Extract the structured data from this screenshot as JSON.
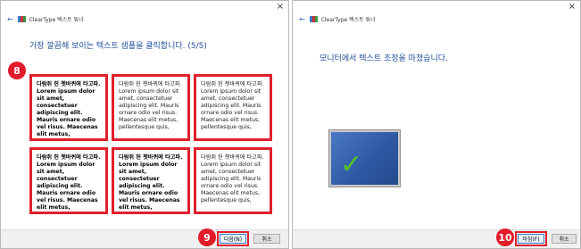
{
  "wizard1": {
    "title": "ClearType 텍스트 튜너",
    "close_glyph": "×",
    "back_glyph": "←",
    "heading": "가장 깔끔해 보이는 텍스트 샘플을 클릭합니다. (5/5)",
    "step_badge": "8",
    "samples": [
      {
        "text": "다람쥐 헌 쳇바퀴에 타고파. Lorem ipsum dolor sit amet, consectetuer adipiscing elit. Mauris ornare odio vel risus. Maecenas elit metus, pellentesque quis,"
      },
      {
        "text": "다람쥐 헌 쳇바퀴에 타고파. Lorem ipsum dolor sit amet, consectetuer adipiscing elit. Mauris ornare odio vel risus. Maecenas elit metus, pellentesque quis,"
      },
      {
        "text": "다람쥐 헌 쳇바퀴에 타고파. Lorem ipsum dolor sit amet, consectetuer adipiscing elit. Mauris ornare odio vel risus. Maecenas elit metus, pellentesque quis,"
      },
      {
        "text": "다람쥐 헌 쳇바퀴에 타고파. Lorem ipsum dolor sit amet, consectetuer adipiscing elit. Mauris ornare odio vel risus. Maecenas elit metus, pellentesque quis,"
      },
      {
        "text": "다람쥐 헌 쳇바퀴에 타고파. Lorem ipsum dolor sit amet, consectetuer adipiscing elit. Mauris ornare odio vel risus. Maecenas elit metus, pellentesque quis,"
      },
      {
        "text": "다람쥐 헌 쳇바퀴에 타고파. Lorem ipsum dolor sit amet, consectetuer adipiscing elit. Mauris ornare odio vel risus. Maecenas elit metus, pellentesque quis,"
      }
    ],
    "footer": {
      "badge": "9",
      "next_label": "다음(N)",
      "cancel_label": "취소"
    }
  },
  "wizard2": {
    "title": "ClearType 텍스트 튜너",
    "close_glyph": "×",
    "back_glyph": "←",
    "heading": "모니터에서 텍스트 조정을 마쳤습니다.",
    "check_glyph": "✓",
    "footer": {
      "badge": "10",
      "finish_label": "마침(F)",
      "cancel_label": "취소"
    }
  },
  "colors": {
    "highlight": "#e0202d",
    "heading": "#1f4f9a",
    "check": "#58c22a"
  }
}
